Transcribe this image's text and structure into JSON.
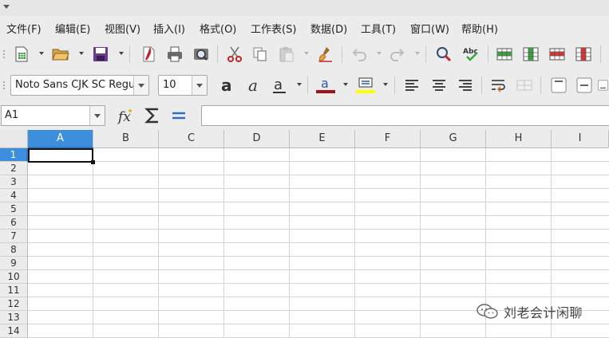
{
  "menubar": {
    "items": [
      {
        "label": "文件(F)"
      },
      {
        "label": "编辑(E)"
      },
      {
        "label": "视图(V)"
      },
      {
        "label": "插入(I)"
      },
      {
        "label": "格式(O)"
      },
      {
        "label": "工作表(S)"
      },
      {
        "label": "数据(D)"
      },
      {
        "label": "工具(T)"
      },
      {
        "label": "窗口(W)"
      },
      {
        "label": "帮助(H)"
      }
    ]
  },
  "formatting": {
    "font_name": "Noto Sans CJK SC Regula",
    "font_size": "10",
    "font_color": "#a50f16",
    "highlight_color": "#ffff00"
  },
  "formula_bar": {
    "name_box": "A1",
    "content": ""
  },
  "grid": {
    "columns": [
      "A",
      "B",
      "C",
      "D",
      "E",
      "F",
      "G",
      "H",
      "I"
    ],
    "rows": [
      "1",
      "2",
      "3",
      "4",
      "5",
      "6",
      "7",
      "8",
      "9",
      "10",
      "11",
      "12",
      "13",
      "14"
    ],
    "active_column": "A",
    "active_row": "1",
    "header_active_color": "#3e8ede"
  },
  "watermark": {
    "text": "刘老会计闲聊"
  }
}
